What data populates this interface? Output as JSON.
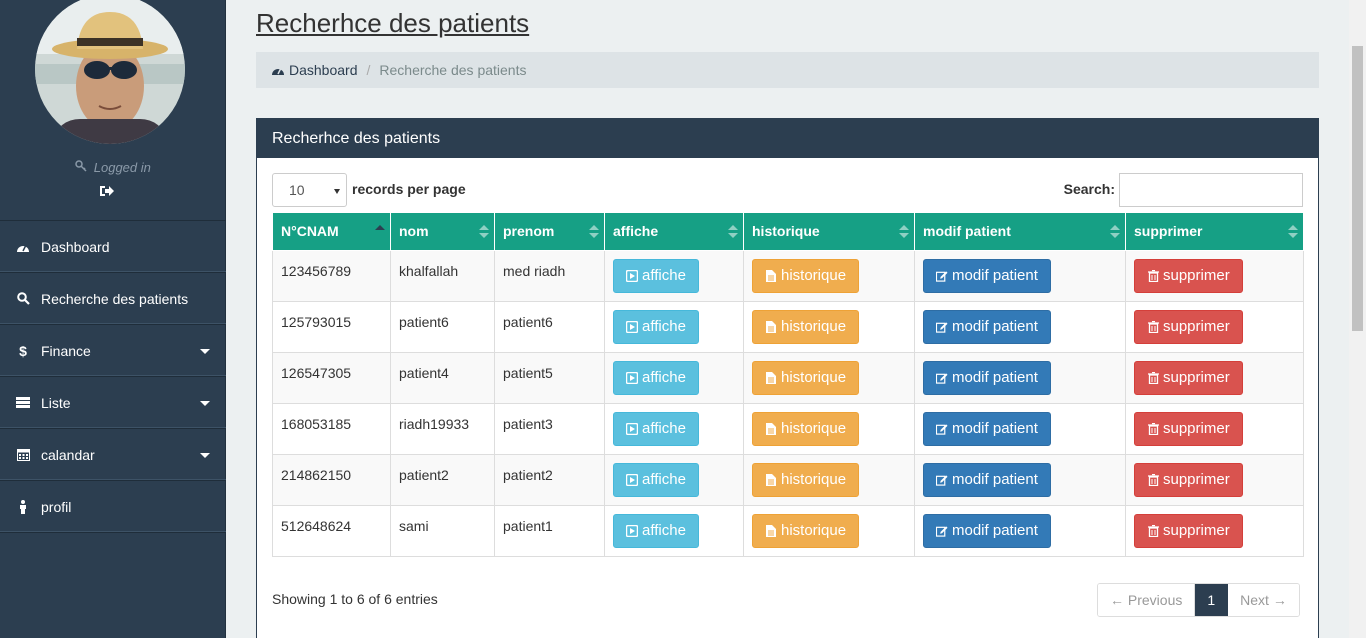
{
  "sidebar": {
    "logged_in": "Logged in",
    "items": [
      {
        "label": "Dashboard",
        "icon": "dashboard-icon"
      },
      {
        "label": "Recherche des patients",
        "icon": "search-icon"
      },
      {
        "label": "Finance",
        "icon": "dollar-icon"
      },
      {
        "label": "Liste",
        "icon": "list-icon"
      },
      {
        "label": "calandar",
        "icon": "calendar-icon"
      },
      {
        "label": "profil",
        "icon": "user-icon"
      }
    ]
  },
  "page": {
    "title": "Recherhce des patients"
  },
  "breadcrumb": {
    "home": "Dashboard",
    "current": "Recherche des patients"
  },
  "panel": {
    "title": "Recherhce des patients",
    "length_value": "10",
    "length_label": "records per page",
    "search_label": "Search:",
    "search_value": ""
  },
  "table": {
    "columns": [
      "N°CNAM",
      "nom",
      "prenom",
      "affiche",
      "historique",
      "modif patient",
      "supprimer"
    ],
    "buttons": {
      "affiche": "affiche",
      "historique": "historique",
      "modif": "modif patient",
      "supprimer": "supprimer"
    },
    "rows": [
      {
        "cnam": "123456789",
        "nom": "khalfallah",
        "prenom": "med riadh"
      },
      {
        "cnam": "125793015",
        "nom": "patient6",
        "prenom": "patient6"
      },
      {
        "cnam": "126547305",
        "nom": "patient4",
        "prenom": "patient5"
      },
      {
        "cnam": "168053185",
        "nom": "riadh19933",
        "prenom": "patient3"
      },
      {
        "cnam": "214862150",
        "nom": "patient2",
        "prenom": "patient2"
      },
      {
        "cnam": "512648624",
        "nom": "sami",
        "prenom": "patient1"
      }
    ]
  },
  "footer": {
    "info": "Showing 1 to 6 of 6 entries",
    "prev": "← Previous",
    "page": "1",
    "next": "Next →"
  },
  "colors": {
    "sidebar": "#2c3e50",
    "table_header": "#16a085",
    "btn_info": "#5bc0de",
    "btn_warning": "#f0ad4e",
    "btn_primary": "#337ab7",
    "btn_danger": "#d9534f"
  }
}
